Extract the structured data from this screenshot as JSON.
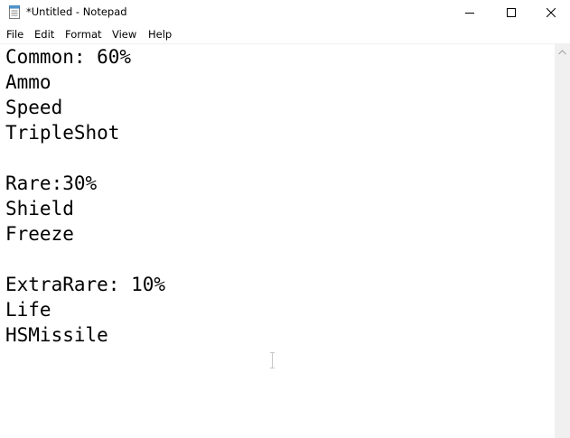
{
  "window": {
    "title": "*Untitled - Notepad"
  },
  "menu": {
    "file": "File",
    "edit": "Edit",
    "format": "Format",
    "view": "View",
    "help": "Help"
  },
  "editor": {
    "lines": [
      "Common: 60%",
      "Ammo",
      "Speed",
      "TripleShot",
      "",
      "Rare:30%",
      "Shield",
      "Freeze",
      "",
      "ExtraRare: 10%",
      "Life",
      "HSMissile"
    ]
  },
  "icons": {
    "app": "notepad-icon",
    "minimize": "minimize-icon",
    "maximize": "maximize-icon",
    "close": "close-icon",
    "scroll_up": "chevron-up-icon",
    "cursor": "text-cursor-icon"
  },
  "colors": {
    "background": "#ffffff",
    "scrollbar": "#f0f0f0",
    "text": "#000000"
  }
}
